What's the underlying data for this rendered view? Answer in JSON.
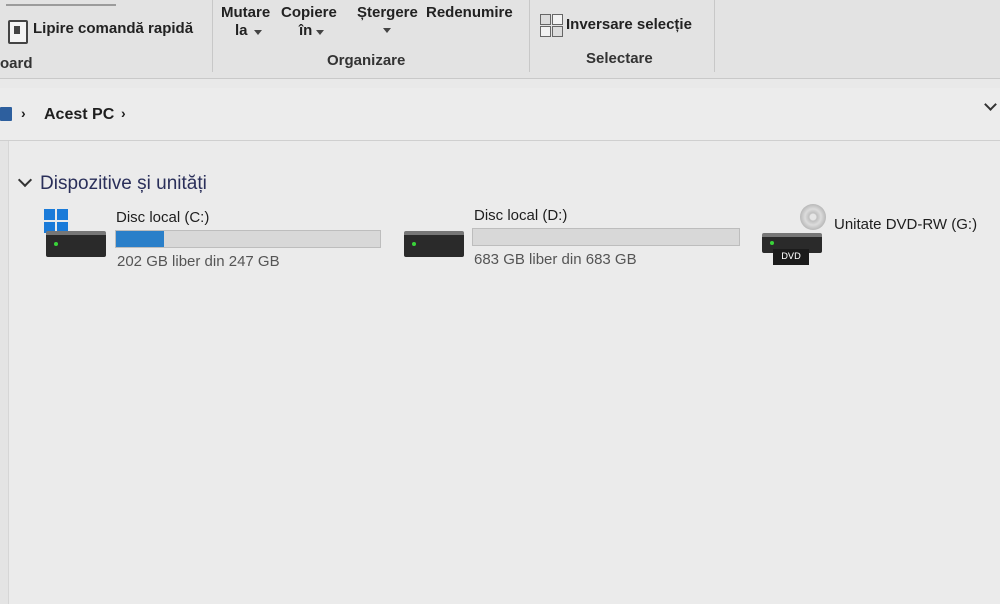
{
  "ribbon": {
    "clipboard": {
      "paste_shortcut_label": "Lipire comandă rapidă",
      "group_label_fragment": "oard"
    },
    "organize": {
      "move_to_line1": "Mutare",
      "move_to_line2": "la",
      "copy_to_line1": "Copiere",
      "copy_to_line2": "în",
      "delete_label": "Ștergere",
      "rename_label": "Redenumire",
      "group_label": "Organizare"
    },
    "select": {
      "invert_selection_label": "Inversare selecție",
      "group_label": "Selectare"
    }
  },
  "address_bar": {
    "location": "Acest PC"
  },
  "section": {
    "title": "Dispozitive și unități"
  },
  "drives": [
    {
      "name": "Disc local (C:)",
      "free_text": "202 GB liber din 247 GB",
      "used_fraction": 0.18,
      "bar_color": "#2a7fc9",
      "icon": "windows-drive-icon"
    },
    {
      "name": "Disc local (D:)",
      "free_text": "683 GB liber din 683 GB",
      "used_fraction": 0.0,
      "bar_color": "#2a7fc9",
      "icon": "hard-drive-icon"
    },
    {
      "name": "Unitate DVD-RW (G:)",
      "icon": "dvd-drive-icon",
      "icon_label": "DVD"
    }
  ]
}
